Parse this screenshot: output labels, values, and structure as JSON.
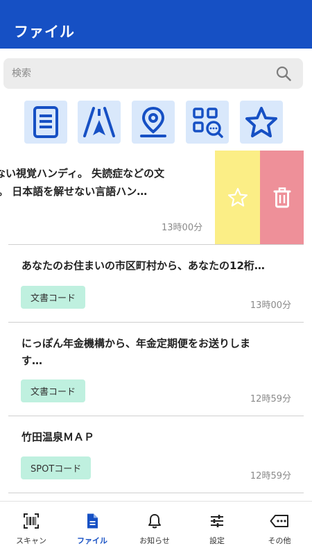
{
  "header": {
    "title": "ファイル"
  },
  "search": {
    "placeholder": "検索"
  },
  "categories": [
    {
      "icon": "document-list-icon"
    },
    {
      "icon": "road-icon"
    },
    {
      "icon": "location-pin-icon"
    },
    {
      "icon": "qr-search-icon"
    },
    {
      "icon": "star-icon"
    }
  ],
  "swiped_item": {
    "line1": "れない視覚ハンディ。 失読症などの文",
    "line2": "。 日本語を解せない言語ハン…",
    "time": "13時00分",
    "favorite_icon": "star-outline-icon",
    "delete_icon": "trash-icon"
  },
  "items": [
    {
      "title": "あなたのお住まいの市区町村から、あなたの12桁…",
      "tag": "文書コード",
      "time": "13時00分"
    },
    {
      "title": "にっぽん年金機構から、年金定期便をお送りしま",
      "title2": "す…",
      "tag": "文書コード",
      "time": "12時59分"
    },
    {
      "title": "竹田温泉ＭＡＰ",
      "tag": "SPOTコード",
      "time": "12時59分"
    }
  ],
  "tabs": [
    {
      "label": "スキャン",
      "icon": "scan-icon"
    },
    {
      "label": "ファイル",
      "icon": "file-icon",
      "active": true
    },
    {
      "label": "お知らせ",
      "icon": "bell-icon"
    },
    {
      "label": "設定",
      "icon": "sliders-icon"
    },
    {
      "label": "その他",
      "icon": "more-icon"
    }
  ],
  "colors": {
    "primary": "#1650c4",
    "category_bg": "#d9e8fb",
    "tag_bg": "#bff0df",
    "favorite_bg": "#fbee86",
    "delete_bg": "#ee9099"
  }
}
